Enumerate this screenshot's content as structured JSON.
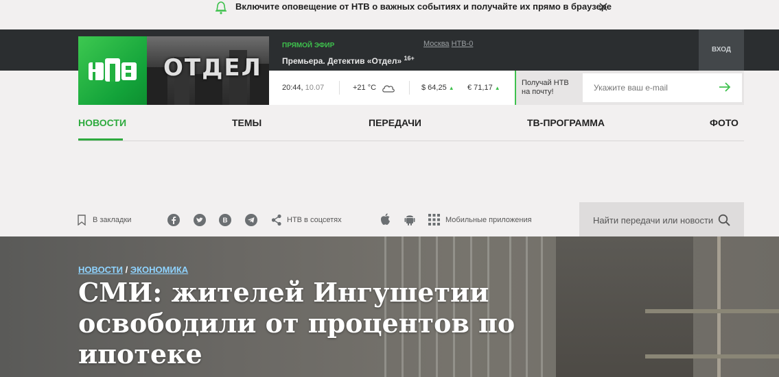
{
  "notification": {
    "text": "Включите оповещение от НТВ о важных событиях и получайте их прямо в браузере",
    "bell_icon": "bell-icon",
    "close_icon": "close-icon"
  },
  "brand": {
    "logo_text": "НТВ",
    "accent_color": "#2eaa3e"
  },
  "promo": {
    "image_word": "ОТДЕЛ"
  },
  "live": {
    "label": "ПРЯМОЙ ЭФИР",
    "title": "Премьера. Детектив «Отдел»",
    "age": "16+",
    "region_city": "Москва",
    "region_channel": "НТВ-0"
  },
  "login": {
    "label": "ВХОД"
  },
  "info": {
    "time": "20:44,",
    "date": "10.07",
    "temperature": "+21 °C",
    "weather_icon": "cloud-icon",
    "usd": "$ 64,25",
    "eur": "€ 71,17",
    "trend_arrow": "▲"
  },
  "subscribe": {
    "label": "Получай НТВ на почту!",
    "placeholder": "Укажите ваш e-mail",
    "submit_icon": "arrow-right-icon"
  },
  "nav": {
    "items": [
      {
        "label": "НОВОСТИ",
        "active": true
      },
      {
        "label": "ТЕМЫ"
      },
      {
        "label": "ПЕРЕДАЧИ"
      },
      {
        "label": "ТВ-ПРОГРАММА"
      },
      {
        "label": "ФОТО"
      }
    ]
  },
  "tools": {
    "bookmark": "В закладки",
    "socials_label": "НТВ в соцсетях",
    "social_icons": [
      "facebook-icon",
      "twitter-icon",
      "vk-icon",
      "telegram-icon",
      "share-icon"
    ],
    "apps_label": "Мобильные приложения",
    "app_icons": [
      "apple-icon",
      "android-icon",
      "grid-icon"
    ]
  },
  "search": {
    "placeholder": "Найти передачи или новости"
  },
  "article": {
    "breadcrumb": [
      "НОВОСТИ",
      "ЭКОНОМИКА"
    ],
    "breadcrumb_sep": " / ",
    "title": "СМИ: жителей Ингушетии освободили от процентов по ипотеке"
  }
}
